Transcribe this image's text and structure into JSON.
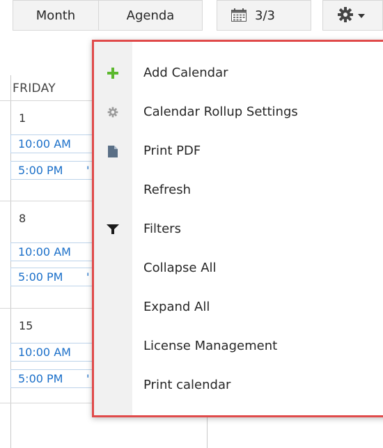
{
  "toolbar": {
    "month_label": "Month",
    "agenda_label": "Agenda",
    "date_label": "3/3",
    "date_icon": "calendar-icon",
    "settings_icon": "gear-icon"
  },
  "calendar": {
    "day_header": "FRIDAY",
    "weeks": [
      {
        "day": "1",
        "events": [
          {
            "time": "10:00 AM",
            "tail": ""
          },
          {
            "time": "5:00 PM",
            "tail": "'"
          }
        ]
      },
      {
        "day": "8",
        "events": [
          {
            "time": "10:00 AM",
            "tail": ""
          },
          {
            "time": "5:00 PM",
            "tail": "'"
          }
        ]
      },
      {
        "day": "15",
        "events": [
          {
            "time": "10:00 AM",
            "tail": ""
          },
          {
            "time": "5:00 PM",
            "tail": "'"
          }
        ]
      }
    ]
  },
  "menu": {
    "items": [
      {
        "label": "Add Calendar",
        "icon": "plus-icon"
      },
      {
        "label": "Calendar Rollup Settings",
        "icon": "gear-icon"
      },
      {
        "label": "Print PDF",
        "icon": "document-icon"
      },
      {
        "label": "Refresh",
        "icon": ""
      },
      {
        "label": "Filters",
        "icon": "filter-icon"
      },
      {
        "label": "Collapse All",
        "icon": ""
      },
      {
        "label": "Expand All",
        "icon": ""
      },
      {
        "label": "License Management",
        "icon": ""
      },
      {
        "label": "Print calendar",
        "icon": ""
      }
    ]
  },
  "colors": {
    "accent_blue": "#1a6fc9",
    "menu_border": "#e04a4a",
    "plus_green": "#5cb82e"
  }
}
